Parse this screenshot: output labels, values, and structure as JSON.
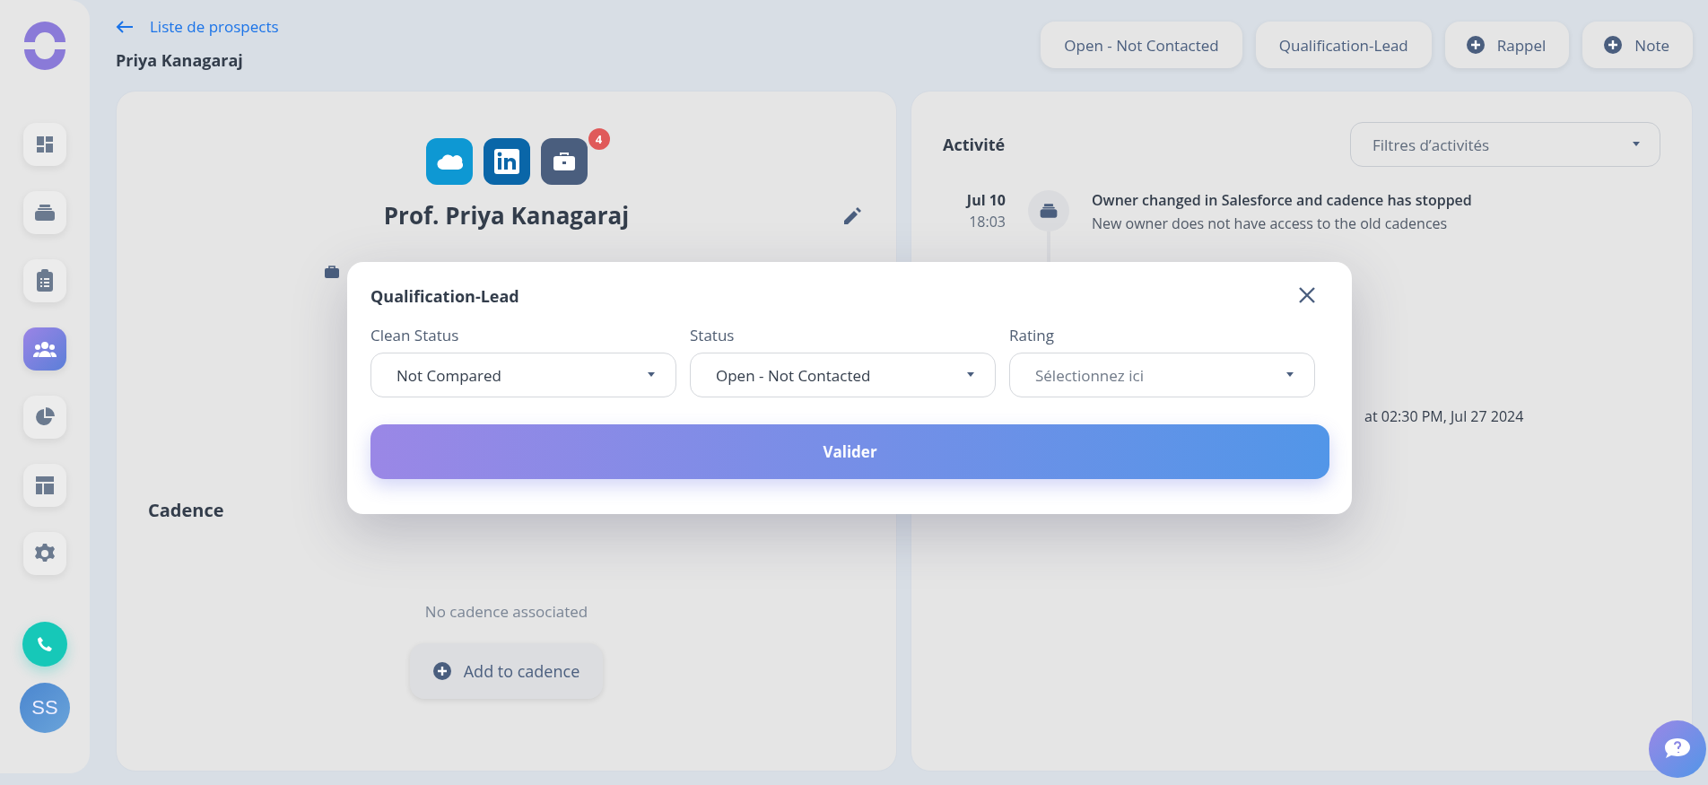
{
  "sidebar": {
    "items": [
      {
        "selected": false
      },
      {
        "selected": false
      },
      {
        "selected": false
      },
      {
        "selected": true
      },
      {
        "selected": false
      },
      {
        "selected": false
      },
      {
        "selected": false
      }
    ],
    "avatar": {
      "initials": "SS"
    }
  },
  "header": {
    "back_link": "Liste de prospects",
    "prospect_name": "Priya Kanagaraj",
    "buttons": [
      {
        "label": "Open - Not Contacted",
        "kind": "plain"
      },
      {
        "label": "Qualification-Lead",
        "kind": "plain"
      },
      {
        "label": "Rappel",
        "kind": "add"
      },
      {
        "label": "Note",
        "kind": "add"
      }
    ]
  },
  "profile": {
    "badge": "4",
    "name": "Prof. Priya Kanagaraj"
  },
  "cadence": {
    "title": "Cadence",
    "empty": "No cadence associated",
    "button": "Add to cadence"
  },
  "activity": {
    "title": "Activité",
    "filter": {
      "placeholder": "Filtres d’activités"
    },
    "items": [
      {
        "date": "Jul 10",
        "time": "18:03",
        "title": "Owner changed in Salesforce and cadence has stopped",
        "description": "New owner does not have access to the old cadences"
      }
    ],
    "partial_text": "at 02:30 PM, Jul 27 2024"
  },
  "modal": {
    "title": "Qualification-Lead",
    "fields": [
      {
        "label": "Clean Status",
        "value": "Not Compared"
      },
      {
        "label": "Status",
        "value": "Open - Not Contacted"
      },
      {
        "label": "Rating",
        "placeholder": "Sélectionnez ici"
      }
    ],
    "submit": "Valider"
  }
}
